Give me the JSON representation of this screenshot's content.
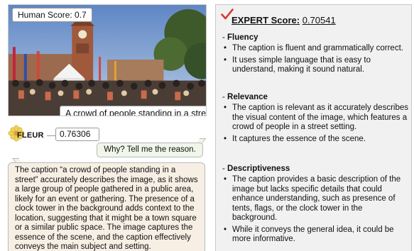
{
  "image_panel": {
    "human_score": "Human Score:  0.7",
    "caption": "A crowd of people standing in a street."
  },
  "fleur": {
    "label": "FLEUR",
    "score": "0.76306",
    "user_question": "Why? Tell me the reason.",
    "explanation": "The caption “a crowd of people standing in a street” accurately describes the image, as it shows a large group of people gathered in a public area, likely for an event or gathering. The presence of a clock tower in the background adds context to the location, suggesting that it might be a town square or a similar public space. The image captures the essence of the scene, and the caption effectively conveys the main subject and setting."
  },
  "expert": {
    "title_label": "EXPERT Score:",
    "score": "0.70541",
    "sections": [
      {
        "heading": "Fluency",
        "bullets": [
          "The caption is fluent and grammatically correct.",
          "It uses simple language that is easy to understand, making it sound natural."
        ]
      },
      {
        "heading": "Relevance",
        "bullets": [
          "The caption is relevant as it accurately describes the visual content of the image, which features a crowd of people in a street setting.",
          "It captures the essence of the scene."
        ]
      },
      {
        "heading": "Descriptiveness",
        "bullets": [
          "The caption provides a basic description of the image but lacks specific details that could enhance understanding, such as presence of tents, flags, or the clock tower in the background.",
          "While it conveys the general idea, it could be more informative."
        ]
      }
    ]
  },
  "colors": {
    "check_mark": "#d8362b",
    "user_bubble": "#f0f6e9",
    "fleur_bubble": "#f7efe4",
    "expert_panel": "#f1f1f1"
  },
  "icons": [
    "flower-icon",
    "check-mark-icon"
  ]
}
